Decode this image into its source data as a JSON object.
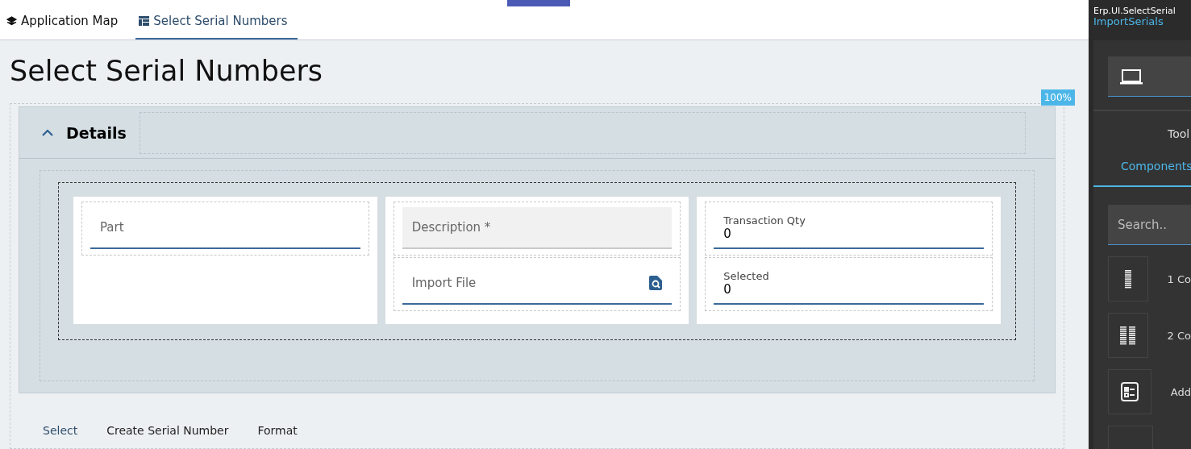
{
  "tabs": [
    {
      "label": "Application Map",
      "selected": false
    },
    {
      "label": "Select Serial Numbers",
      "selected": true
    }
  ],
  "page_title": "Select Serial Numbers",
  "zoom_badge": "100%",
  "panel": {
    "title": "Details",
    "expanded": true
  },
  "columns": [
    {
      "fields": [
        {
          "kind": "placeholder",
          "label": "Part"
        }
      ]
    },
    {
      "fields": [
        {
          "kind": "readonly",
          "label": "Description *"
        },
        {
          "kind": "search",
          "label": "Import File"
        }
      ]
    },
    {
      "fields": [
        {
          "kind": "value",
          "label": "Transaction Qty",
          "value": "0"
        },
        {
          "kind": "value",
          "label": "Selected",
          "value": "0"
        }
      ]
    }
  ],
  "bottom_tabs": [
    {
      "label": "Select",
      "selected": true
    },
    {
      "label": "Create Serial Number",
      "selected": false
    },
    {
      "label": "Format",
      "selected": false
    }
  ],
  "side_panel": {
    "header_line_1": "Erp.UI.SelectSerial",
    "header_line_2": "ImportSerials",
    "tabs": [
      {
        "label": "Tool",
        "selected": false
      },
      {
        "label": "Components",
        "selected": true
      }
    ],
    "search_placeholder": "Search..",
    "items": [
      {
        "kind": "one-column",
        "label": "1 Co"
      },
      {
        "kind": "two-column",
        "label": "2 Co"
      },
      {
        "kind": "form",
        "label": "Add"
      },
      {
        "kind": "blank"
      }
    ]
  }
}
